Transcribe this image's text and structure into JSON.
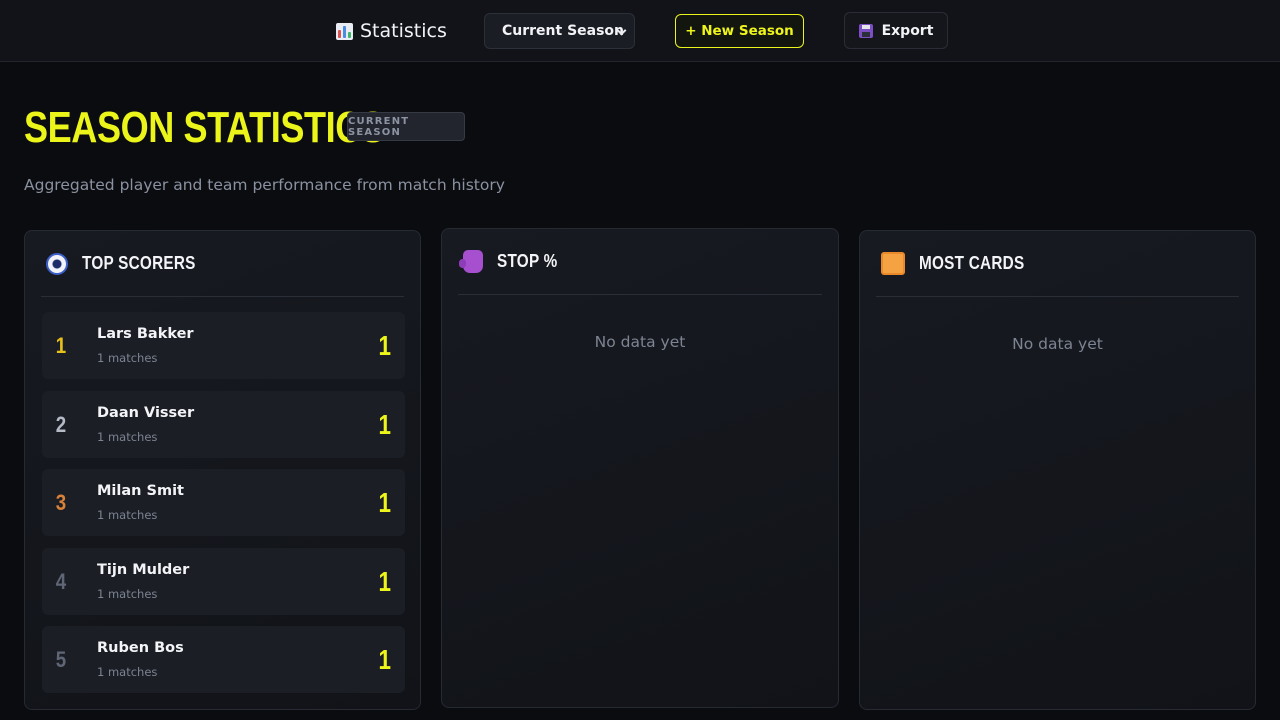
{
  "topbar": {
    "title": "Statistics",
    "title_icon": "bar-chart-icon",
    "season_select": {
      "selected": "Current Season"
    },
    "new_season_label": "+ New Season",
    "export_label": "Export",
    "export_icon": "floppy-disk-icon"
  },
  "page": {
    "title": "SEASON STATISTICS",
    "badge": "CURRENT SEASON",
    "subtitle": "Aggregated player and team performance from match history"
  },
  "panels": {
    "top_scorers": {
      "title": "TOP SCORERS",
      "icon": "soccer-ball-icon",
      "rows": [
        {
          "rank": "1",
          "name": "Lars Bakker",
          "matches": "1 matches",
          "goals": "1",
          "rank_color": "#e8c21a"
        },
        {
          "rank": "2",
          "name": "Daan Visser",
          "matches": "1 matches",
          "goals": "1",
          "rank_color": "#b4bac6"
        },
        {
          "rank": "3",
          "name": "Milan Smit",
          "matches": "1 matches",
          "goals": "1",
          "rank_color": "#d9823a"
        },
        {
          "rank": "4",
          "name": "Tijn Mulder",
          "matches": "1 matches",
          "goals": "1",
          "rank_color": "#5f6675"
        },
        {
          "rank": "5",
          "name": "Ruben Bos",
          "matches": "1 matches",
          "goals": "1",
          "rank_color": "#5f6675"
        }
      ]
    },
    "stop_pct": {
      "title": "STOP %",
      "icon": "goalkeeper-glove-icon",
      "empty": "No data yet"
    },
    "most_cards": {
      "title": "MOST CARDS",
      "icon": "yellow-card-icon",
      "empty": "No data yet"
    }
  },
  "colors": {
    "accent": "#eef51a",
    "background": "#0b0c10"
  }
}
